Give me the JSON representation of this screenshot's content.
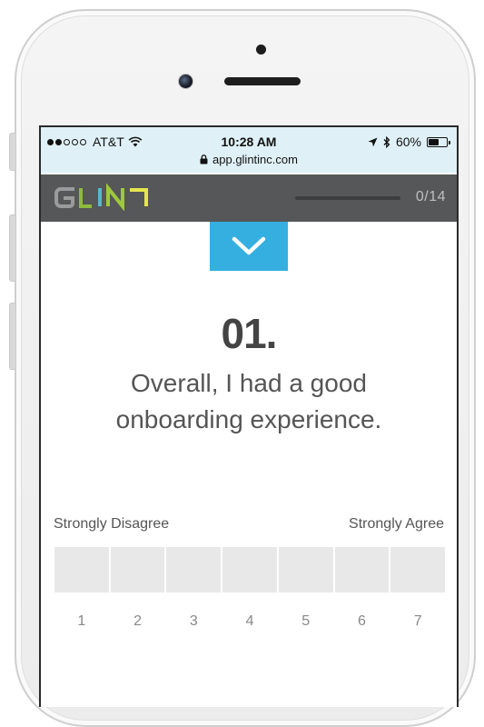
{
  "status_bar": {
    "carrier": "AT&T",
    "time": "10:28 AM",
    "battery": "60%",
    "battery_level": 0.6,
    "signal_bars_filled": 2,
    "signal_bars_total": 5
  },
  "browser": {
    "url": "app.glintinc.com"
  },
  "header": {
    "logo_text": "GLINT",
    "progress_label": "0/14",
    "progress_fraction": 0,
    "colors": {
      "bg": "#555758",
      "logo_gray": "#9a9c9c",
      "logo_green": "#9ec93c",
      "logo_yellow": "#e6e64a"
    }
  },
  "question": {
    "number": "01.",
    "text_line1": "Overall, I had a good",
    "text_line2": "onboarding experience."
  },
  "scale": {
    "min_label": "Strongly Disagree",
    "max_label": "Strongly Agree",
    "options": [
      "1",
      "2",
      "3",
      "4",
      "5",
      "6",
      "7"
    ]
  },
  "colors": {
    "accent": "#35aee0",
    "status_bg": "#dff1f7",
    "box": "#e9e8e9"
  }
}
